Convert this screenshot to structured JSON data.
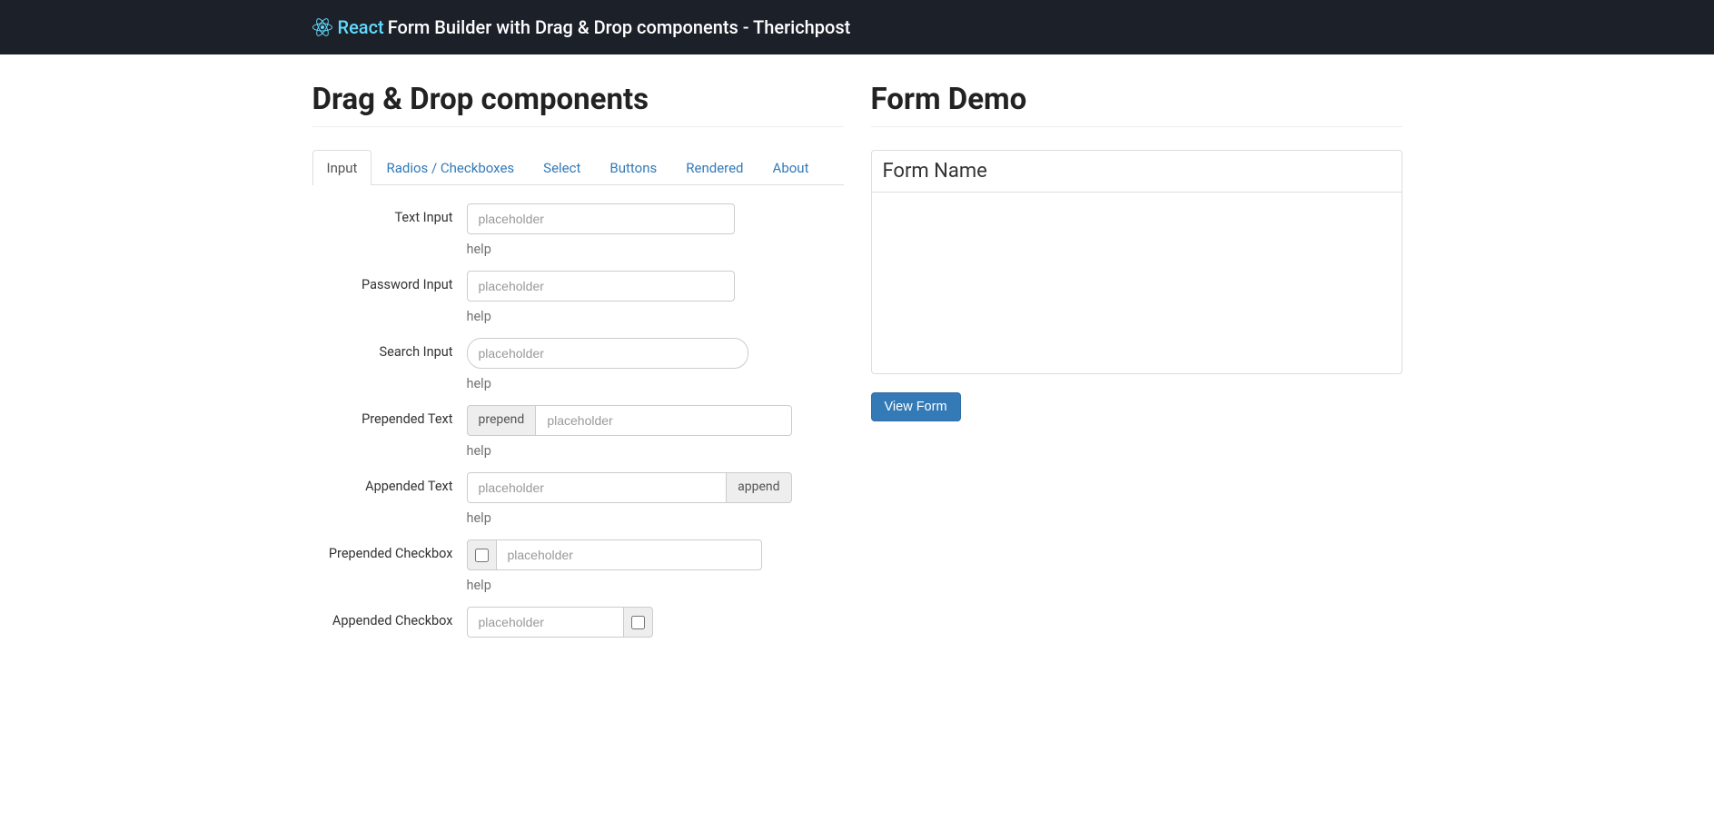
{
  "navbar": {
    "react": "React",
    "title": "Form Builder with Drag & Drop components - Therichpost"
  },
  "left": {
    "header": "Drag & Drop components",
    "tabs": [
      "Input",
      "Radios / Checkboxes",
      "Select",
      "Buttons",
      "Rendered",
      "About"
    ],
    "components": {
      "text": {
        "label": "Text Input",
        "placeholder": "placeholder",
        "help": "help"
      },
      "password": {
        "label": "Password Input",
        "placeholder": "placeholder",
        "help": "help"
      },
      "search": {
        "label": "Search Input",
        "placeholder": "placeholder",
        "help": "help"
      },
      "prepText": {
        "label": "Prepended Text",
        "addon": "prepend",
        "placeholder": "placeholder",
        "help": "help"
      },
      "appText": {
        "label": "Appended Text",
        "addon": "append",
        "placeholder": "placeholder",
        "help": "help"
      },
      "prepCb": {
        "label": "Prepended Checkbox",
        "placeholder": "placeholder",
        "help": "help"
      },
      "appCb": {
        "label": "Appended Checkbox",
        "placeholder": "placeholder"
      }
    }
  },
  "right": {
    "header": "Form Demo",
    "panelTitle": "Form Name",
    "viewBtn": "View Form"
  }
}
